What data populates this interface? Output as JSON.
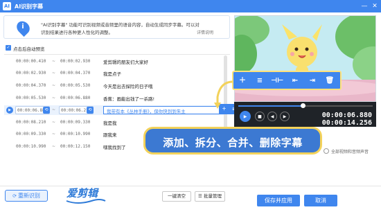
{
  "window": {
    "title": "AI识别字幕",
    "icon": "app-logo-icon"
  },
  "notice": {
    "icon": "info-icon",
    "text": "\"AI识别字幕\" 功能可识别视频或音频里的语音内容，自动生成同步字幕。可以对识别结果进行各种更人性化的调整。",
    "link": "详情说明"
  },
  "autoplay": {
    "checked": true,
    "label": "点击后自动预览"
  },
  "subtitles": [
    {
      "start": "00:00:00.410",
      "end": "00:00:02.930",
      "text": "爱剪辑的朋友们大家好"
    },
    {
      "start": "00:00:02.930",
      "end": "00:00:04.370",
      "text": "我是点子"
    },
    {
      "start": "00:00:04.370",
      "end": "00:00:05.530",
      "text": "今天是出去探险的日子哦"
    },
    {
      "start": "00:00:05.530",
      "end": "00:00:06.880",
      "text": "香蕉：画能出钱了一杀路!"
    },
    {
      "start": "00:00:06.880",
      "end": "00:00:06.210",
      "text": "我带有本《丛林手册》，保你快到到朱主",
      "active": true
    },
    {
      "start": "00:00:08.210",
      "end": "00:00:09.330",
      "text": "我是我"
    },
    {
      "start": "00:00:09.330",
      "end": "00:00:10.990",
      "text": "跟我来"
    },
    {
      "start": "00:00:10.990",
      "end": "00:00:12.150",
      "text": "嘿我找到了"
    }
  ],
  "player": {
    "current_time": "00:00:06.880",
    "total_time": "00:00:14.256",
    "progress": 0.48
  },
  "tools": {
    "icons": [
      "add-subtitle-icon",
      "split-subtitle-icon",
      "merge-subtitle-icon",
      "insert-before-icon",
      "insert-after-icon",
      "delete-icon"
    ]
  },
  "banner": {
    "text": "添加、拆分、合并、删除字幕"
  },
  "audio_option": {
    "label": "全部视频和音频声音",
    "checked": false
  },
  "footer": {
    "re_recognize": "重新识别",
    "clear_all": "一键清空",
    "batch_manage": "批量管理",
    "save_apply": "保存并应用",
    "cancel": "取消"
  },
  "logo": {
    "text": "爱剪辑"
  },
  "colors": {
    "accent": "#3f86ee",
    "banner": "#3c79d2",
    "banner_border": "#f3d25a"
  }
}
